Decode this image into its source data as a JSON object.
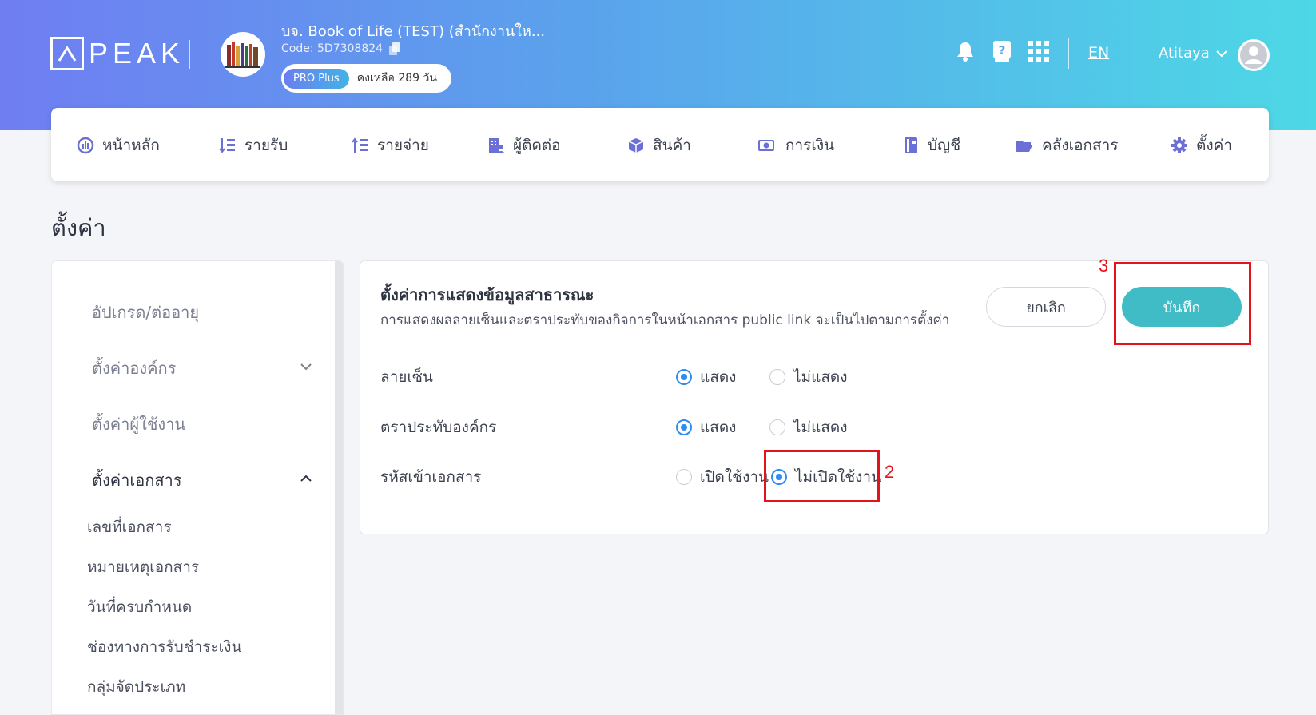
{
  "header": {
    "logo_text": "PEAK",
    "company_name": "บจ. Book of Life (TEST) (สำนักงานให...",
    "company_code": "Code: 5D7308824",
    "plan_label": "PRO Plus",
    "plan_days": "คงเหลือ 289 วัน",
    "lang": "EN",
    "username": "Atitaya"
  },
  "nav": {
    "items": [
      {
        "label": "หน้าหลัก",
        "icon": "dashboard-icon"
      },
      {
        "label": "รายรับ",
        "icon": "income-icon"
      },
      {
        "label": "รายจ่าย",
        "icon": "expense-icon"
      },
      {
        "label": "ผู้ติดต่อ",
        "icon": "contacts-icon"
      },
      {
        "label": "สินค้า",
        "icon": "product-icon"
      },
      {
        "label": "การเงิน",
        "icon": "finance-icon"
      },
      {
        "label": "บัญชี",
        "icon": "accounting-icon"
      },
      {
        "label": "คลังเอกสาร",
        "icon": "folder-icon"
      },
      {
        "label": "ตั้งค่า",
        "icon": "gear-icon"
      }
    ]
  },
  "page": {
    "title": "ตั้งค่า"
  },
  "sidebar": {
    "items": [
      {
        "label": "อัปเกรด/ต่ออายุ"
      },
      {
        "label": "ตั้งค่าองค์กร"
      },
      {
        "label": "ตั้งค่าผู้ใช้งาน"
      },
      {
        "label": "ตั้งค่าเอกสาร"
      }
    ],
    "subitems": [
      {
        "label": "เลขที่เอกสาร"
      },
      {
        "label": "หมายเหตุเอกสาร"
      },
      {
        "label": "วันที่ครบกำหนด"
      },
      {
        "label": "ช่องทางการรับชำระเงิน"
      },
      {
        "label": "กลุ่มจัดประเภท"
      }
    ]
  },
  "panel": {
    "title": "ตั้งค่าการแสดงข้อมูลสาธารณะ",
    "description": "การแสดงผลลายเซ็นและตราประทับของกิจการในหน้าเอกสาร public link จะเป็นไปตามการตั้งค่า",
    "cancel_label": "ยกเลิก",
    "save_label": "บันทึก",
    "rows": [
      {
        "label": "ลายเซ็น",
        "opt1": "แสดง",
        "opt2": "ไม่แสดง",
        "selected": "แสดง"
      },
      {
        "label": "ตราประทับองค์กร",
        "opt1": "แสดง",
        "opt2": "ไม่แสดง",
        "selected": "แสดง"
      },
      {
        "label": "รหัสเข้าเอกสาร",
        "opt1": "เปิดใช้งาน",
        "opt2": "ไม่เปิดใช้งาน",
        "selected": "ไม่เปิดใช้งาน"
      }
    ]
  },
  "annotations": {
    "num2": "2",
    "num3": "3"
  }
}
